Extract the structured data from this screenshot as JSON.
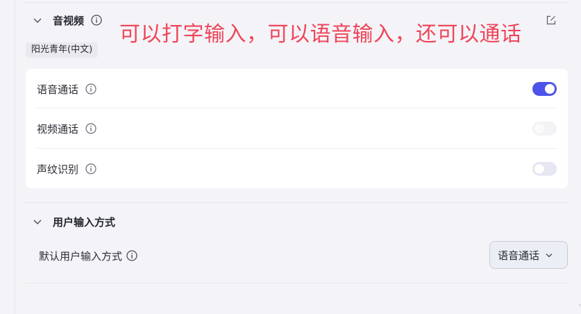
{
  "annotation": "可以打字输入，可以语音输入，还可以通话",
  "av_section": {
    "title": "音视频",
    "voice_tag": "阳光青年(中文)",
    "settings": [
      {
        "label": "语音通话",
        "enabled": true,
        "state": "on"
      },
      {
        "label": "视频通话",
        "enabled": false,
        "state": "disabled"
      },
      {
        "label": "声纹识别",
        "enabled": false,
        "state": "off"
      }
    ]
  },
  "input_section": {
    "title": "用户输入方式",
    "default_label": "默认用户输入方式",
    "selected_value": "语音通话"
  },
  "colors": {
    "accent": "#4d53e8",
    "annotation": "#f0455a",
    "background": "#f4f4f8"
  },
  "icons": [
    "chevron-down-icon",
    "info-icon",
    "edit-icon",
    "caret-down-icon"
  ]
}
